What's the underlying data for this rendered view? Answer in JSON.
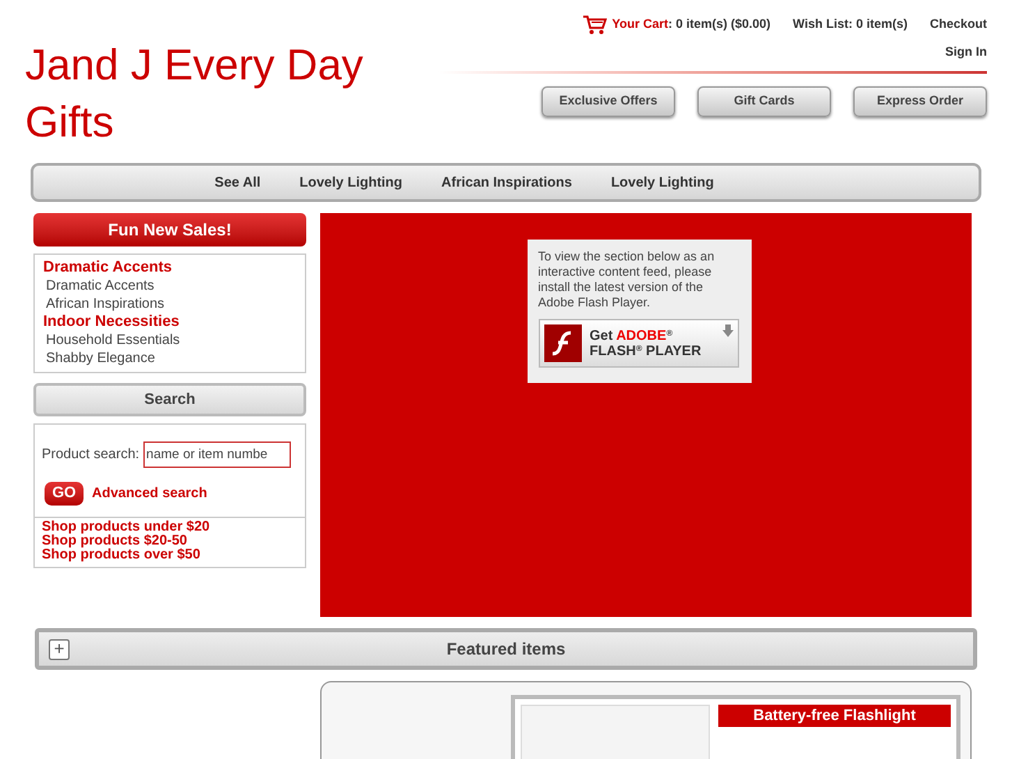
{
  "site_title": "Jand J Every Day Gifts",
  "header_links": {
    "cart_label": "Your Cart",
    "cart_value": ": 0 item(s) ($0.00)",
    "wish_list": "Wish List: 0 item(s)",
    "checkout": "Checkout",
    "sign_in": "Sign In"
  },
  "header_buttons": [
    "Exclusive Offers",
    "Gift Cards",
    "Express Order"
  ],
  "nav": [
    "See All",
    "Lovely Lighting",
    "African Inspirations",
    "Lovely Lighting"
  ],
  "sidebar": {
    "sales_button": "Fun New Sales!",
    "categories": [
      {
        "label": "Dramatic Accents",
        "children": [
          {
            "label": "Dramatic Accents"
          },
          {
            "label": "African Inspirations"
          }
        ]
      },
      {
        "label": "Indoor Necessities",
        "children": [
          {
            "label": "Household Essentials"
          },
          {
            "label": "Shabby Elegance"
          }
        ]
      }
    ],
    "search": {
      "heading": "Search",
      "label": "Product search:",
      "placeholder": "name or item numbe",
      "go": "GO",
      "advanced": "Advanced search"
    },
    "price_links": [
      "Shop products under $20",
      "Shop products $20-50",
      "Shop products over $50"
    ]
  },
  "flash_notice": {
    "text": "To view the section below as an interactive content feed, please install the latest version of the Adobe Flash Player.",
    "badge_get": "Get",
    "badge_brand": "ADOBE",
    "badge_product": "FLASH",
    "badge_player": "PLAYER",
    "mark": "®"
  },
  "featured": {
    "heading": "Featured items",
    "expand": "+",
    "product_title": "Battery-free Flashlight"
  }
}
